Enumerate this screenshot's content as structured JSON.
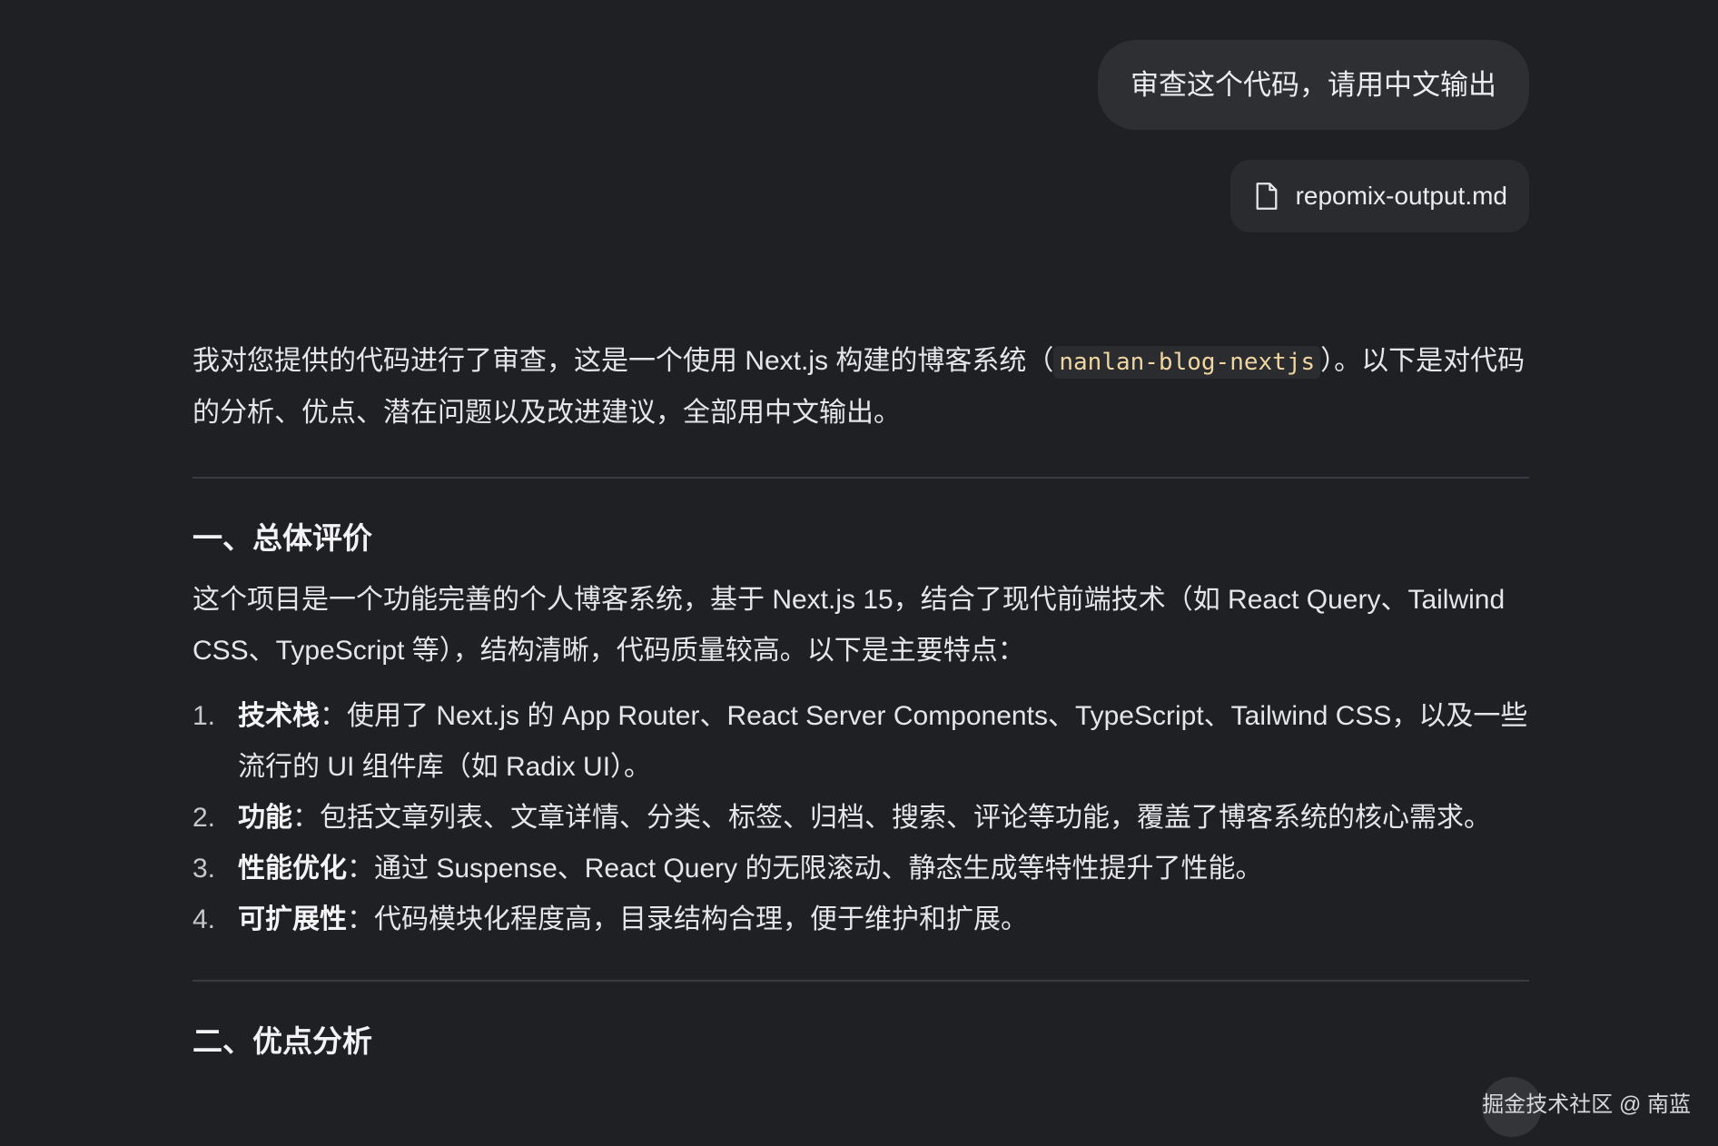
{
  "user_message": {
    "text": "审查这个代码，请用中文输出",
    "attachment_name": "repomix-output.md",
    "attachment_icon": "file-icon"
  },
  "answer": {
    "intro_before_code": "我对您提供的代码进行了审查，这是一个使用 Next.js 构建的博客系统（",
    "intro_code": "nanlan-blog-nextjs",
    "intro_after_code": "）。以下是对代码的分析、优点、潜在问题以及改进建议，全部用中文输出。",
    "section1": {
      "heading": "一、总体评价",
      "paragraph": "这个项目是一个功能完善的个人博客系统，基于 Next.js 15，结合了现代前端技术（如 React Query、Tailwind CSS、TypeScript 等），结构清晰，代码质量较高。以下是主要特点：",
      "items": [
        {
          "num": "1.",
          "title": "技术栈",
          "text": "：使用了 Next.js 的 App Router、React Server Components、TypeScript、Tailwind CSS，以及一些流行的 UI 组件库（如 Radix UI）。"
        },
        {
          "num": "2.",
          "title": "功能",
          "text": "：包括文章列表、文章详情、分类、标签、归档、搜索、评论等功能，覆盖了博客系统的核心需求。"
        },
        {
          "num": "3.",
          "title": "性能优化",
          "text": "：通过 Suspense、React Query 的无限滚动、静态生成等特性提升了性能。"
        },
        {
          "num": "4.",
          "title": "可扩展性",
          "text": "：代码模块化程度高，目录结构合理，便于维护和扩展。"
        }
      ]
    },
    "section2": {
      "heading": "二、优点分析"
    }
  },
  "watermark": "掘金技术社区 @ 南蓝",
  "colors": {
    "background": "#1f2023",
    "bubble": "#2e2f33",
    "inline_code_text": "#f0d6a0",
    "divider": "#3a3b40"
  }
}
